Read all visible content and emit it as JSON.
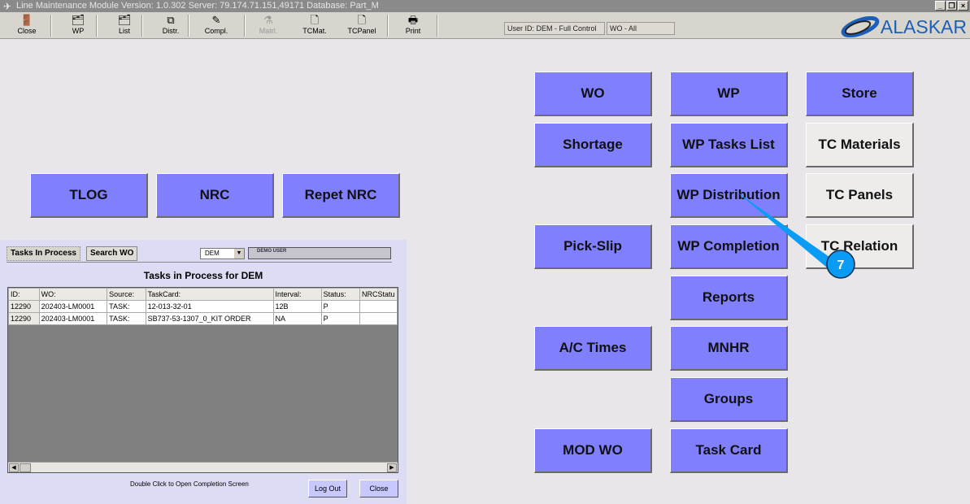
{
  "title": "Line Maintenance Module  Version: 1.0.302 Server: 79.174.71.151,49171 Database: Part_M",
  "toolbar": [
    {
      "label": "Close",
      "icon": "door-exit-icon",
      "glyph": "🚪"
    },
    {
      "label": "WP",
      "icon": "printer-folder-icon",
      "glyph": "🗂"
    },
    {
      "label": "List",
      "icon": "list-icon",
      "glyph": "🗂"
    },
    {
      "label": "Distr.",
      "icon": "distribute-icon",
      "glyph": "⧉"
    },
    {
      "label": "Compl.",
      "icon": "complete-icon",
      "glyph": "✎"
    },
    {
      "label": "Matrl.",
      "icon": "material-icon",
      "glyph": "⚗",
      "disabled": true
    },
    {
      "label": "TCMat.",
      "icon": "document-icon",
      "glyph": "🗋"
    },
    {
      "label": "TCPanel",
      "icon": "document-icon",
      "glyph": "🗋"
    },
    {
      "label": "Print",
      "icon": "printer-icon",
      "glyph": "🖶"
    }
  ],
  "status": {
    "user": "User ID: DEM - Full Control",
    "wo": "WO - All"
  },
  "logo": "ALASKAR",
  "buttons": {
    "tlog": "TLOG",
    "nrc": "NRC",
    "repet_nrc": "Repet NRC",
    "wo": "WO",
    "shortage": "Shortage",
    "pick_slip": "Pick-Slip",
    "ac_times": "A/C Times",
    "mod_wo": "MOD WO",
    "wp": "WP",
    "wp_tasks_list": "WP Tasks List",
    "wp_distribution": "WP Distribution",
    "wp_completion": "WP Completion",
    "reports": "Reports",
    "mnhr": "MNHR",
    "groups": "Groups",
    "task_card": "Task Card",
    "store": "Store",
    "tc_materials": "TC Materials",
    "tc_panels": "TC Panels",
    "tc_relation": "TC Relation"
  },
  "panel": {
    "tabs": [
      "Tasks In Process",
      "Search WO"
    ],
    "user_select": "DEM",
    "user_name": "DEMO USER",
    "title": "Tasks in Process for DEM",
    "columns": [
      "ID:",
      "WO:",
      "Source:",
      "TaskCard:",
      "Interval:",
      "Status:",
      "NRCStatu"
    ],
    "rows": [
      [
        "12290",
        "202403-LM0001",
        "TASK:",
        "12-013-32-01",
        "12B",
        "P",
        ""
      ],
      [
        "12290",
        "202403-LM0001",
        "TASK:",
        "SB737-53-1307_0_KIT ORDER",
        "NA",
        "P",
        ""
      ]
    ],
    "hint": "Double Click to Open Completion Screen",
    "logout": "Log Out",
    "close": "Close"
  },
  "callout": "7"
}
